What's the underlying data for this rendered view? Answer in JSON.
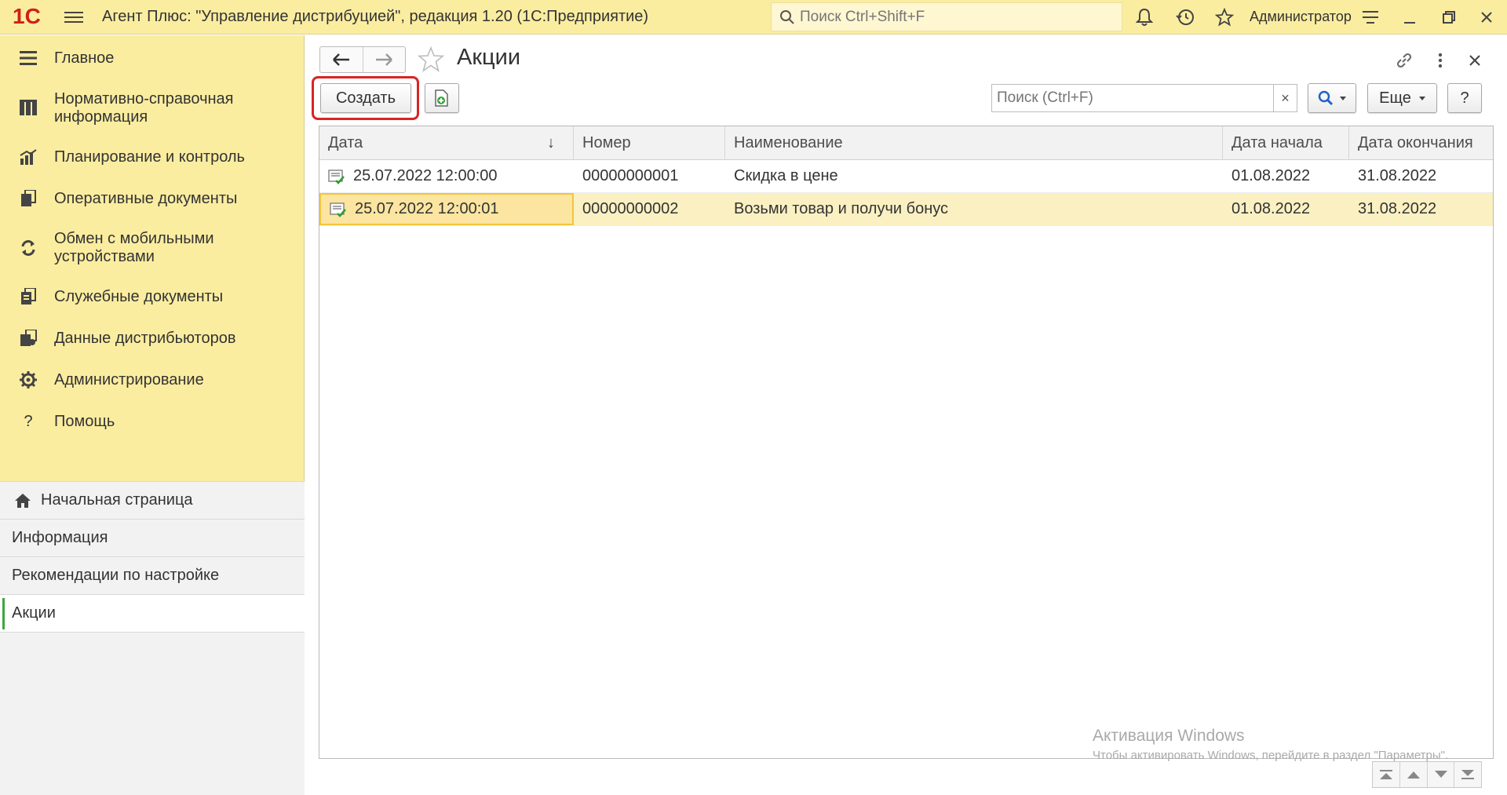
{
  "titlebar": {
    "logo_text": "1С",
    "app_title": "Агент Плюс: \"Управление дистрибуцией\", редакция 1.20  (1С:Предприятие)",
    "search_placeholder": "Поиск Ctrl+Shift+F",
    "user_name": "Администратор",
    "icons": [
      "menu-icon",
      "search-icon",
      "bell-icon",
      "history-icon",
      "star-icon",
      "settings-lines-icon",
      "minimize-icon",
      "restore-icon",
      "close-icon"
    ]
  },
  "sidebar": {
    "items": [
      {
        "label": "Главное",
        "icon": "menu-lines-icon"
      },
      {
        "label": "Нормативно-справочная информация",
        "icon": "catalog-icon"
      },
      {
        "label": "Планирование и контроль",
        "icon": "chart-icon"
      },
      {
        "label": "Оперативные документы",
        "icon": "documents-icon"
      },
      {
        "label": "Обмен с мобильными устройствами",
        "icon": "sync-icon"
      },
      {
        "label": "Служебные документы",
        "icon": "service-docs-icon"
      },
      {
        "label": "Данные дистрибьюторов",
        "icon": "distributor-data-icon"
      },
      {
        "label": "Администрирование",
        "icon": "gear-icon"
      },
      {
        "label": "Помощь",
        "icon": "help-icon"
      }
    ],
    "open_windows": [
      {
        "label": "Начальная страница",
        "icon": "home-icon"
      },
      {
        "label": "Информация"
      },
      {
        "label": "Рекомендации по настройке"
      },
      {
        "label": "Акции",
        "active": true
      }
    ]
  },
  "form": {
    "title": "Акции",
    "create_label": "Создать",
    "search_placeholder": "Поиск (Ctrl+F)",
    "clear_label": "×",
    "more_label": "Еще",
    "help_label": "?",
    "accent_color": "#d92424"
  },
  "table": {
    "columns": [
      "Дата",
      "Номер",
      "Наименование",
      "Дата начала",
      "Дата окончания"
    ],
    "sort_indicator": "↓",
    "rows": [
      {
        "date": "25.07.2022 12:00:00",
        "number": "00000000001",
        "name": "Скидка в цене",
        "start": "01.08.2022",
        "end": "31.08.2022",
        "selected": false
      },
      {
        "date": "25.07.2022 12:00:01",
        "number": "00000000002",
        "name": "Возьми товар и получи бонус",
        "start": "01.08.2022",
        "end": "31.08.2022",
        "selected": true
      }
    ]
  },
  "watermark": {
    "line1": "Активация Windows",
    "line2": "Чтобы активировать Windows, перейдите в раздел \"Параметры\"."
  }
}
